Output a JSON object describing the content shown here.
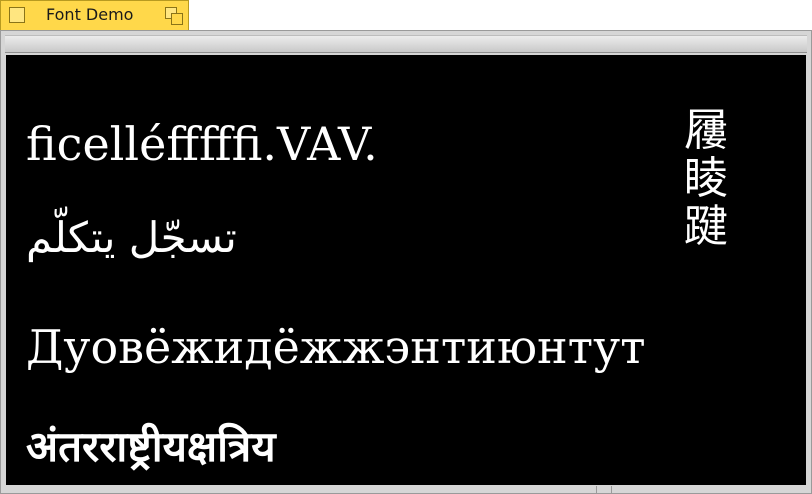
{
  "window": {
    "title": "Font Demo"
  },
  "canvas": {
    "background": "#000000",
    "text_color": "#ffffff",
    "samples": {
      "latin": "ficelléffffﬁ.VAV.",
      "arabic": "تسجّل يتكلّم",
      "cyrillic": "Дуовёжидёжжэнтиюнтут",
      "devanagari": "अंतरराष्ट्रीयक्षत्रिय",
      "cjk_vertical": "屨睖踺"
    }
  },
  "colors": {
    "tab_background": "#ffd84a",
    "frame": "#d6d6d6"
  },
  "icons": {
    "left_box": "square-icon",
    "right_box": "restore-icon"
  }
}
